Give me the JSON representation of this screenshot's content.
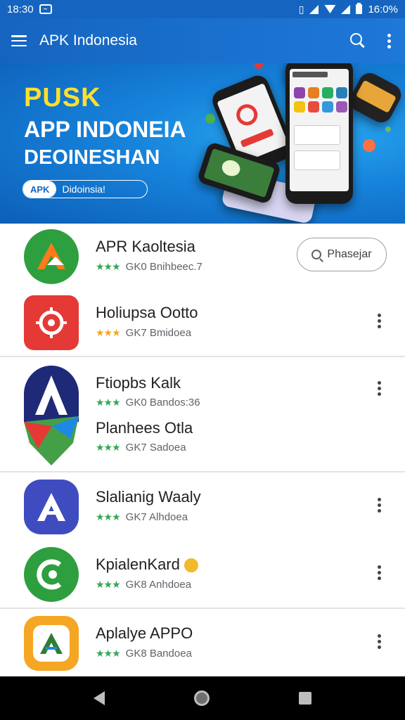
{
  "status_bar": {
    "time_left": "18:30",
    "time_right": "16:0%",
    "icons": [
      "notification-icon",
      "vibrate-icon",
      "signal-icon",
      "wifi-icon",
      "battery-icon"
    ]
  },
  "app_bar": {
    "title": "APK Indonesia",
    "icons": [
      "menu-icon",
      "search-icon",
      "more-vert-icon"
    ]
  },
  "banner": {
    "line1": "PUSK",
    "line2": "APP INDONEIA",
    "line3": "DEOINESHAN",
    "chip_left": "APK",
    "chip_right": "Didoinsia!",
    "colors": {
      "headline_yellow": "#ffe02a",
      "background": "#1784dc"
    }
  },
  "apps": [
    {
      "name": "APR Kaoltesia",
      "stars": "★★★",
      "meta": "GK0 Bnihbeec.7",
      "icon": "green-arrow-logo",
      "icon_color": "#2e9f3e",
      "action": "Phasejar"
    },
    {
      "name": "Holiupsa Ootto",
      "stars": "★★★",
      "meta": "GK7 Bmidoea",
      "icon": "red-target-logo",
      "icon_color": "#e53935"
    },
    {
      "name": "Ftiopbs Kalk",
      "stars": "★★★",
      "meta": "GK0 Bandos:36",
      "icon": "blue-a-logo",
      "icon_color": "#1e2a78"
    },
    {
      "name": "Planhees Otla",
      "stars": "★★★",
      "meta": "GK7 Sadoea",
      "icon": "red-green-logo",
      "icon_color": "#e53935"
    },
    {
      "name": "Slalianig Waaly",
      "stars": "★★★",
      "meta": "GK7 Alhdoea",
      "icon": "indigo-a-logo",
      "icon_color": "#3f4cc0"
    },
    {
      "name": "KpialenKard",
      "stars": "★★★",
      "meta": "GK8 Anhdoea",
      "icon": "green-c-logo",
      "icon_color": "#2e9f3e"
    },
    {
      "name": "Aplalye APPO",
      "stars": "★★★",
      "meta": "GK8 Bandoea",
      "icon": "orange-a-logo",
      "icon_color": "#f5a623"
    }
  ]
}
